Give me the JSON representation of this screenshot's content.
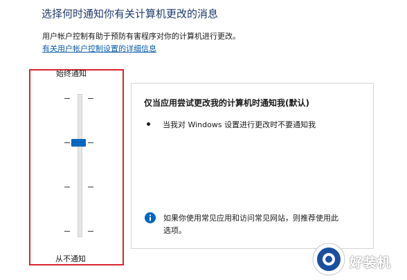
{
  "header": {
    "title": "选择何时通知你有关计算机更改的消息",
    "description": "用户帐户控制有助于预防有害程序对你的计算机进行更改。",
    "link": "有关用户帐户控制设置的详细信息"
  },
  "slider": {
    "top_label": "始终通知",
    "bottom_label": "从不通知",
    "levels": 4,
    "selected_level_from_bottom": 3
  },
  "panel": {
    "heading": "仅当应用尝试更改我的计算机时通知我(默认)",
    "bullet": "当我对 Windows 设置进行更改时不要通知我",
    "info_line1": "如果你使用常见应用和访问常见网站，则推荐使用此",
    "info_line2": "选项。",
    "info_icon": "info-icon"
  },
  "watermark": {
    "text": "好装机"
  },
  "colors": {
    "title": "#1e3a6e",
    "link": "#0b5cad",
    "highlight_border": "#d8232a",
    "thumb": "#0067c0",
    "info_icon": "#0067c0"
  }
}
